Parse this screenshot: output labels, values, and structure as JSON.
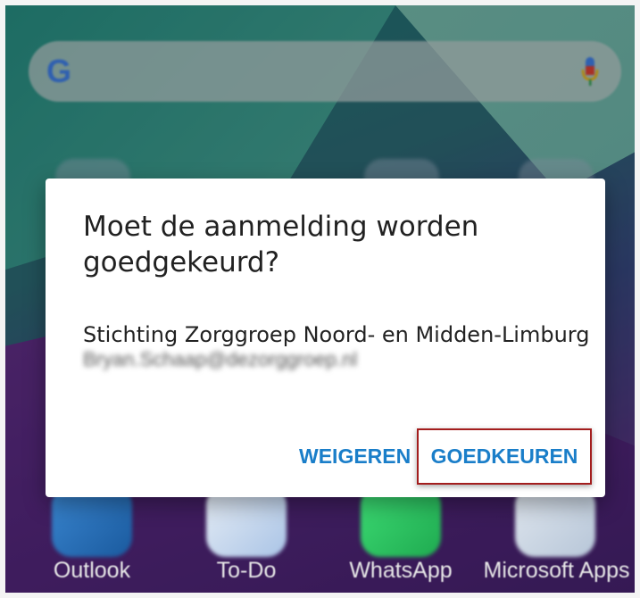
{
  "dialog": {
    "title": "Moet de aanmelding worden goedgekeurd?",
    "organization": "Stichting Zorggroep Noord- en Midden-Limburg",
    "email": "Bryan.Schaap@dezorggroep.nl",
    "deny_label": "WEIGEREN",
    "approve_label": "GOEDKEUREN"
  },
  "search": {
    "logo": "G"
  },
  "dock": [
    {
      "label": "Outlook",
      "icon": "outlook-icon"
    },
    {
      "label": "To-Do",
      "icon": "todo-icon"
    },
    {
      "label": "WhatsApp",
      "icon": "whatsapp-icon"
    },
    {
      "label": "Microsoft Apps",
      "icon": "microsoft-apps-icon"
    }
  ],
  "colors": {
    "accent": "#1a7ec9",
    "highlight": "#a31d1d",
    "whatsapp": "#25d366"
  }
}
